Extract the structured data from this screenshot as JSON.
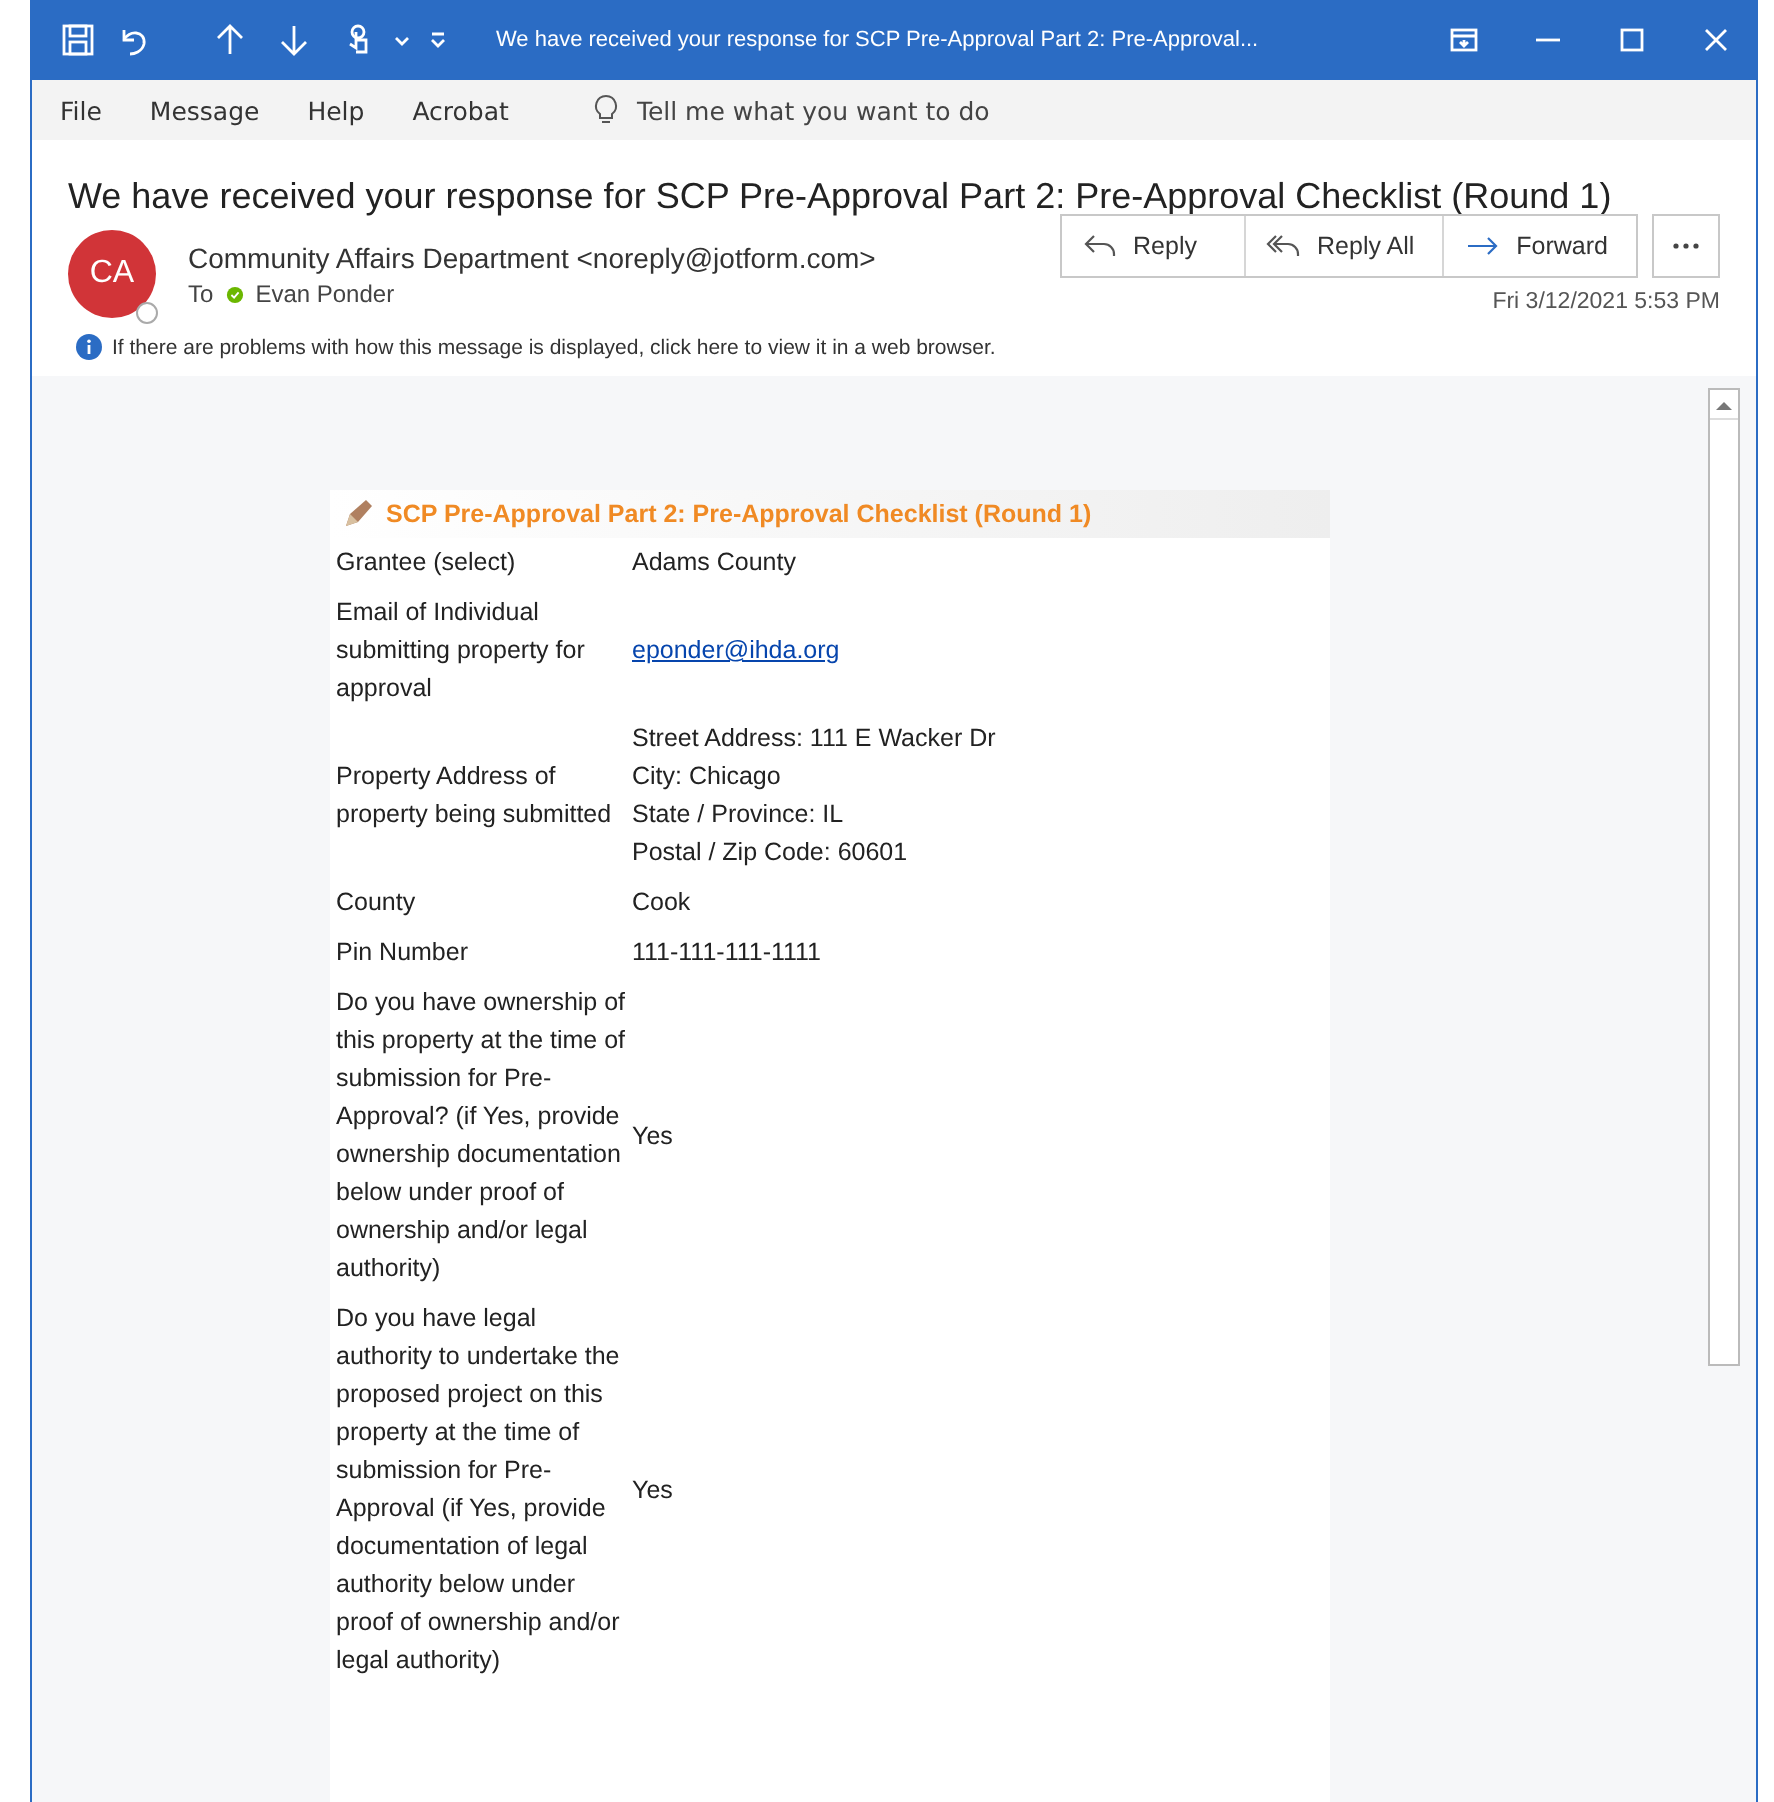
{
  "window": {
    "title": "We have received your response for SCP Pre-Approval Part 2: Pre-Approval..."
  },
  "menu": [
    {
      "label": "File"
    },
    {
      "label": "Message"
    },
    {
      "label": "Help"
    },
    {
      "label": "Acrobat"
    }
  ],
  "tell_me": {
    "placeholder": "Tell me what you want to do"
  },
  "message": {
    "subject": "We have received your response for SCP Pre-Approval Part 2: Pre-Approval Checklist (Round 1)",
    "sender": {
      "initials": "CA",
      "name": "Community Affairs Department <noreply@jotform.com>"
    },
    "to_label": "To",
    "recipient": "Evan Ponder",
    "date": "Fri 3/12/2021 5:53 PM",
    "actions": [
      {
        "kind": "reply",
        "label": "Reply"
      },
      {
        "kind": "reply_all",
        "label": "Reply All"
      },
      {
        "kind": "forward",
        "label": "Forward"
      }
    ],
    "info_bar": "If there are problems with how this message is displayed, click here to view it in a web browser."
  },
  "form": {
    "title": "SCP Pre-Approval Part 2: Pre-Approval Checklist (Round 1)",
    "rows": [
      {
        "label": "Grantee (select)",
        "kind": "text",
        "value": [
          "Adams County"
        ]
      },
      {
        "label": "Email of Individual submitting property for approval",
        "kind": "link",
        "value": [
          "eponder@ihda.org"
        ]
      },
      {
        "label": "Property Address of property being submitted",
        "kind": "text",
        "value": [
          "Street Address: 111 E Wacker Dr",
          "City: Chicago",
          "State / Province: IL",
          "Postal / Zip Code: 60601"
        ]
      },
      {
        "label": "County",
        "kind": "text",
        "value": [
          "Cook"
        ]
      },
      {
        "label": "Pin Number",
        "kind": "text",
        "value": [
          "111-111-111-1111"
        ]
      },
      {
        "label": "Do you have ownership of this property at the time of submission for Pre-Approval? (if Yes, provide ownership documentation below under proof of ownership and/or legal authority)",
        "kind": "text",
        "value": [
          "Yes"
        ]
      },
      {
        "label": "Do you have legal authority to undertake the proposed project on this property at the time of submission for Pre-Approval (if Yes, provide documentation of legal authority below under proof of ownership and/or legal authority)",
        "kind": "text",
        "value": [
          "Yes"
        ]
      }
    ]
  }
}
